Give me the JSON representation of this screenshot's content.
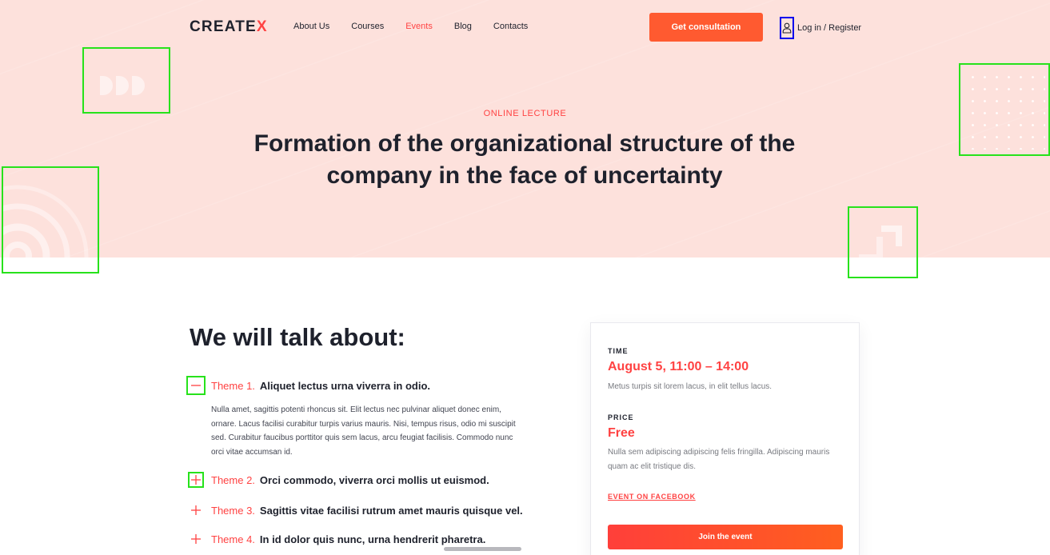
{
  "brand": {
    "name_main": "CREATE",
    "name_accent": "X",
    "accent_color": "#ff4242",
    "hero_bg": "#fde1dc"
  },
  "nav": {
    "items": [
      {
        "label": "About Us",
        "active": false
      },
      {
        "label": "Courses",
        "active": false
      },
      {
        "label": "Events",
        "active": true
      },
      {
        "label": "Blog",
        "active": false
      },
      {
        "label": "Contacts",
        "active": false
      }
    ],
    "cta_label": "Get consultation",
    "login_label": "Log in / Register",
    "login_icon": "user-icon"
  },
  "hero": {
    "kicker": "ONLINE LECTURE",
    "title": "Formation of the organizational structure of the company in the face of uncertainty"
  },
  "content": {
    "heading": "We will talk about:",
    "themes": [
      {
        "number": "Theme 1.",
        "title": "Aliquet lectus urna viverra in odio.",
        "expanded": true,
        "icon": "minus-icon"
      },
      {
        "number": "Theme 2.",
        "title": "Orci commodo, viverra orci mollis ut euismod.",
        "expanded": false,
        "icon": "plus-icon"
      },
      {
        "number": "Theme 3.",
        "title": "Sagittis vitae facilisi rutrum amet mauris quisque vel.",
        "expanded": false,
        "icon": "plus-icon"
      },
      {
        "number": "Theme 4.",
        "title": "In id dolor quis nunc, urna hendrerit pharetra.",
        "expanded": false,
        "icon": "plus-icon"
      }
    ],
    "theme1_body": "Nulla amet, sagittis potenti rhoncus sit. Elit lectus nec pulvinar aliquet donec enim, ornare. Lacus facilisi curabitur turpis varius mauris. Nisi, tempus risus, odio mi suscipit sed. Curabitur faucibus porttitor quis sem lacus, arcu feugiat facilisis. Commodo nunc orci vitae accumsan id."
  },
  "event_card": {
    "time_label": "TIME",
    "time_value": "August 5, 11:00 – 14:00",
    "time_desc": "Metus turpis sit lorem lacus, in elit tellus lacus.",
    "price_label": "PRICE",
    "price_value": "Free",
    "price_desc": "Nulla sem adipiscing adipiscing felis fringilla. Adipiscing mauris quam ac elit tristique dis.",
    "facebook_link": "EVENT ON FACEBOOK",
    "join_label": "Join the event"
  }
}
